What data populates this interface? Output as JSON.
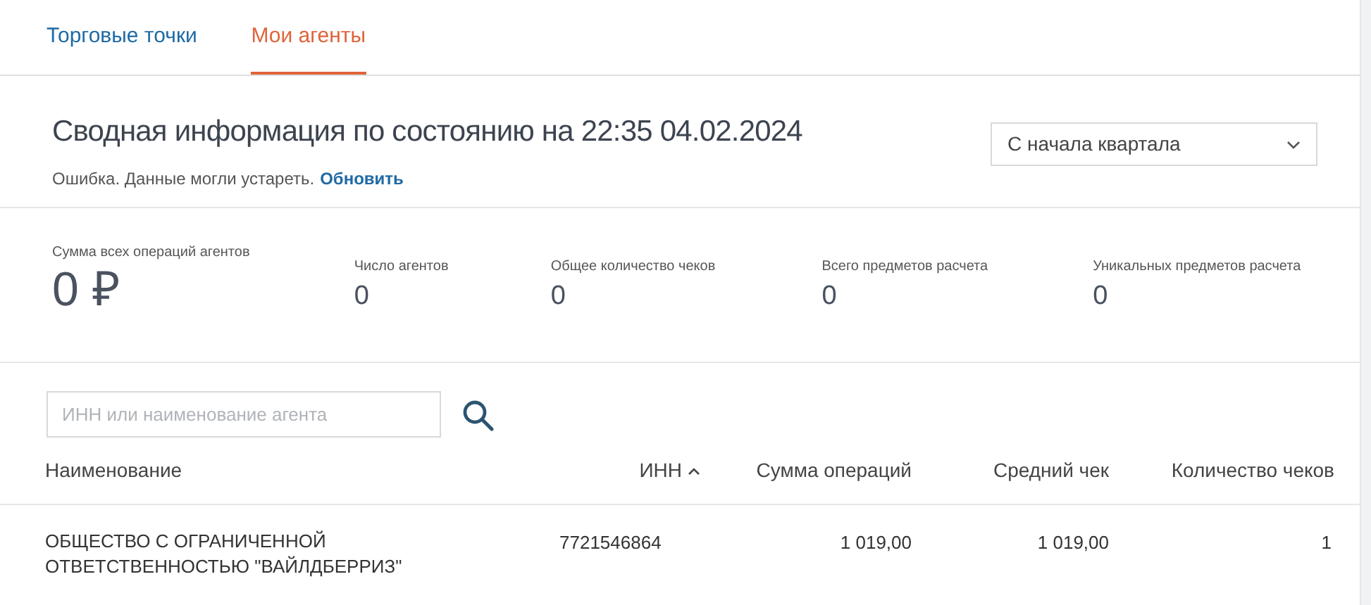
{
  "tabs": [
    {
      "label": "Торговые точки",
      "selected": false
    },
    {
      "label": "Мои агенты",
      "selected": true
    }
  ],
  "summary": {
    "title": "Сводная информация по состоянию на 22:35 04.02.2024",
    "status": "Ошибка. Данные могли устареть.",
    "refresh_link": "Обновить",
    "period_select": {
      "value": "С начала квартала"
    }
  },
  "stats": [
    {
      "label": "Сумма всех операций агентов",
      "value": "0 ₽",
      "kind": "primary"
    },
    {
      "label": "Число агентов",
      "value": "0",
      "kind": "secondary"
    },
    {
      "label": "Общее количество чеков",
      "value": "0",
      "kind": "secondary"
    },
    {
      "label": "Всего предметов расчета",
      "value": "0",
      "kind": "secondary"
    },
    {
      "label": "Уникальных предметов расчета",
      "value": "0",
      "kind": "secondary"
    }
  ],
  "search": {
    "placeholder": "ИНН или наименование агента"
  },
  "table": {
    "columns": [
      {
        "label": "Наименование",
        "sorted": false
      },
      {
        "label": "ИНН",
        "sorted": true
      },
      {
        "label": "Сумма операций",
        "sorted": false
      },
      {
        "label": "Средний чек",
        "sorted": false
      },
      {
        "label": "Количество чеков",
        "sorted": false
      }
    ],
    "rows": [
      [
        "ОБЩЕСТВО С ОГРАНИЧЕННОЙ ОТВЕТСТВЕННОСТЬЮ \"ВАЙЛДБЕРРИЗ\"",
        "7721546864",
        "1 019,00",
        "1 019,00",
        "1"
      ]
    ]
  }
}
